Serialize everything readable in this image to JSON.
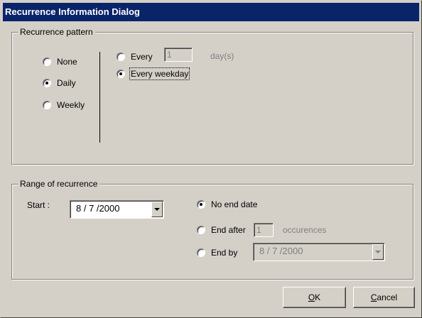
{
  "window": {
    "title": "Recurrence Information Dialog"
  },
  "pattern": {
    "legend": "Recurrence pattern",
    "options": [
      {
        "label": "None",
        "checked": false
      },
      {
        "label": "Daily",
        "checked": true
      },
      {
        "label": "Weekly",
        "checked": false
      }
    ],
    "daily": {
      "every_label": "Every",
      "every_value": "1",
      "every_unit": "day(s)",
      "weekday_label": "Every weekday",
      "every_checked": false,
      "weekday_checked": true
    }
  },
  "range": {
    "legend": "Range of recurrence",
    "start_label": "Start :",
    "start_value": "8 / 7 /2000",
    "no_end_label": "No end date",
    "end_after_label": "End after",
    "end_after_value": "1",
    "occurrences_label": "occurences",
    "end_by_label": "End by",
    "end_by_value": "8 / 7 /2000",
    "selected": "no_end"
  },
  "buttons": {
    "ok_mnemonic": "O",
    "ok_rest": "K",
    "cancel_mnemonic": "C",
    "cancel_rest": "ancel"
  }
}
